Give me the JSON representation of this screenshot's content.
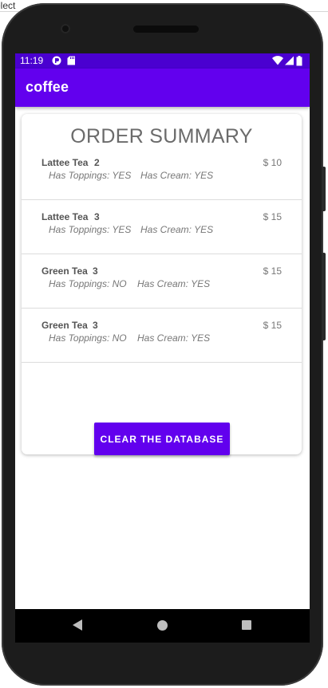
{
  "host": {
    "fragment": "elect"
  },
  "status_bar": {
    "time": "11:19",
    "left_icons": [
      "app-notification-icon",
      "sd-card-icon"
    ],
    "right_icons": [
      "wifi-icon",
      "cell-signal-icon",
      "battery-icon"
    ]
  },
  "app_bar": {
    "title": "coffee",
    "color": "#6200ee"
  },
  "summary": {
    "title": "ORDER SUMMARY",
    "toppings_label": "Has Toppings:",
    "cream_label": "Has Cream:",
    "currency": "$",
    "orders": [
      {
        "name": "Lattee Tea",
        "qty": "2",
        "price": "$ 10",
        "toppings": "Has Toppings: YES",
        "cream": "Has Cream: YES"
      },
      {
        "name": "Lattee Tea",
        "qty": "3",
        "price": "$ 15",
        "toppings": "Has Toppings: YES",
        "cream": "Has Cream: YES"
      },
      {
        "name": "Green Tea",
        "qty": "3",
        "price": "$ 15",
        "toppings": "Has Toppings: NO",
        "cream": "Has Cream: YES"
      },
      {
        "name": "Green Tea",
        "qty": "3",
        "price": "$ 15",
        "toppings": "Has Toppings: NO",
        "cream": "Has Cream: YES"
      }
    ],
    "clear_button": "CLEAR THE DATABASE"
  },
  "nav_bar": {
    "icons": [
      "back-icon",
      "home-icon",
      "recents-icon"
    ]
  },
  "colors": {
    "status_bar": "#4a00d0",
    "primary": "#6200ee"
  }
}
